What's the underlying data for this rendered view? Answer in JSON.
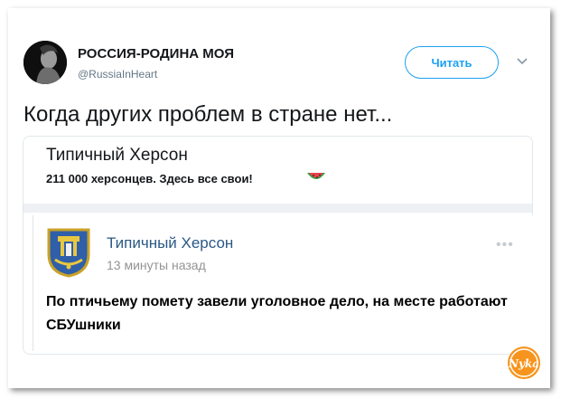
{
  "tweet": {
    "author_name": "РОССИЯ-РОДИНА МОЯ",
    "author_handle": "@RussiaInHeart",
    "follow_label": "Читать",
    "text": "Когда других проблем в стране нет..."
  },
  "quoted_page": {
    "title": "Типичный Херсон",
    "description": "211 000 херсонцев. Здесь все свои!"
  },
  "post": {
    "author": "Типичный Херсон",
    "time": "13 минуты назад",
    "more": "•••",
    "text": "По птичьему помету завели уголовное дело, на месте работают СБУшники"
  },
  "watermark": {
    "text": "Nyka"
  },
  "colors": {
    "accent": "#1da1f2",
    "vk_link": "#2a5885",
    "muted": "#657786",
    "watermark_orange": "#f7941d"
  },
  "icons": {
    "avatar": "avatar-portrait",
    "caret": "chevron-down-icon",
    "melon": "watermelon-icon",
    "logo": "kherson-coat-of-arms",
    "watermark": "nyka-logo"
  }
}
